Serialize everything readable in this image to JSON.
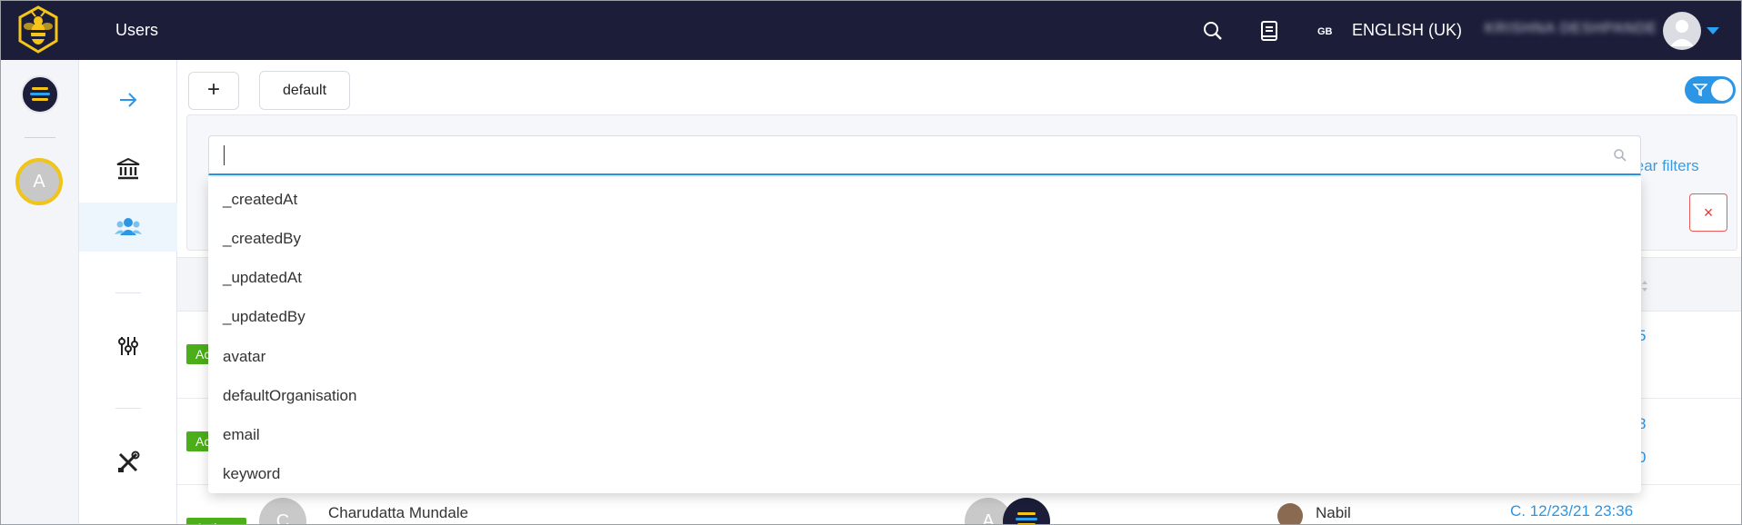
{
  "topbar": {
    "title": "Users",
    "lang_code": "GB",
    "language": "ENGLISH (UK)",
    "username": "KRISHNA DESHPANDE"
  },
  "rail": {
    "avatar_letter": "A"
  },
  "toolbar": {
    "add_label": "+",
    "default_label": "default"
  },
  "filter": {
    "search_value": "",
    "clear_filters_label": "lear filters",
    "clear_icon": "×"
  },
  "dropdown": {
    "items": [
      "_createdAt",
      "_createdBy",
      "_updatedAt",
      "_updatedBy",
      "avatar",
      "defaultOrganisation",
      "email",
      "keyword"
    ]
  },
  "rows": [
    {
      "badge": "Ac",
      "date_a": "5",
      "date_b": ""
    },
    {
      "badge": "Ac",
      "date_a": "8",
      "date_b": "0"
    },
    {
      "badge": "Acti",
      "name": "Charudatta Mundale",
      "avatar_letter": "C",
      "org_avatar": "A",
      "owner": "Nabil",
      "date": "C. 12/23/21 23:36"
    }
  ],
  "colors": {
    "topbar": "#1b1d39",
    "accent": "#2b96e6",
    "active_badge": "#4caf1a",
    "danger": "#e03c3c"
  }
}
